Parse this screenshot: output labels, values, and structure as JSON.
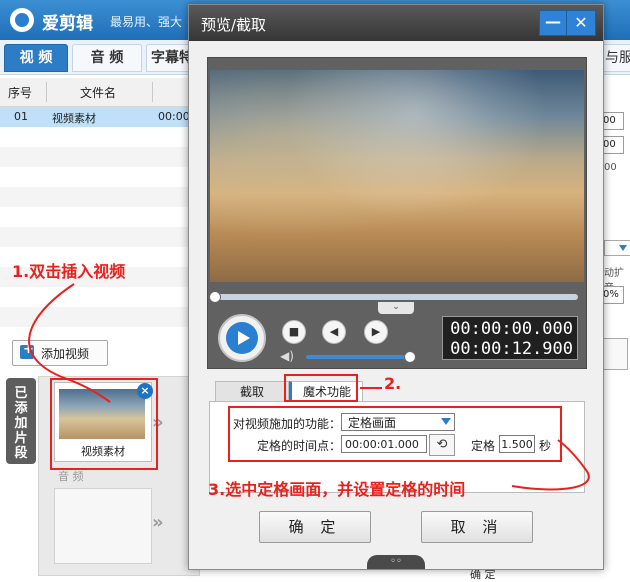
{
  "app": {
    "title": "爱剪辑",
    "subtitle": "最易用、强大",
    "tabs": [
      "视 频",
      "音 频",
      "字幕特",
      "与服务"
    ],
    "table": {
      "headers": [
        "序号",
        "文件名"
      ],
      "rows": [
        {
          "index": "01",
          "name": "视频素材",
          "time": "00:00"
        }
      ]
    },
    "add_video_label": "添加视频",
    "side_label": "已添加片段",
    "clip_name": "视频素材",
    "audio_strip_label": "音 频",
    "right_fields": [
      "00",
      "00",
      "00"
    ],
    "right_texts": [
      "动扩音",
      "0%"
    ],
    "bottom_right_text": "确 定"
  },
  "dialog": {
    "title": "预览/截取",
    "min_icon": "minimize-icon",
    "close_icon": "close-icon",
    "timecode_current": "00:00:00.000",
    "timecode_total": "00:00:12.900",
    "scrub_tab": "⌄",
    "tabs": {
      "cut": "截取",
      "magic": "魔术功能"
    },
    "function_label": "对视频施加的功能：",
    "function_value": "定格画面",
    "timepoint_label": "定格的时间点：",
    "timepoint_value": "00:00:01.000",
    "freeze_label": "定格",
    "freeze_value": "1.500",
    "freeze_unit": "秒",
    "ok_label": "确 定",
    "cancel_label": "取 消",
    "playback_position": 0.0,
    "volume_level": 0.95
  },
  "annotations": {
    "step1": "1.双击插入视频",
    "step2": "2.",
    "step3": "3.选中定格画面，并设置定格的时间"
  },
  "colors": {
    "accent": "#2d7cc6",
    "annotation": "#e8211c"
  }
}
